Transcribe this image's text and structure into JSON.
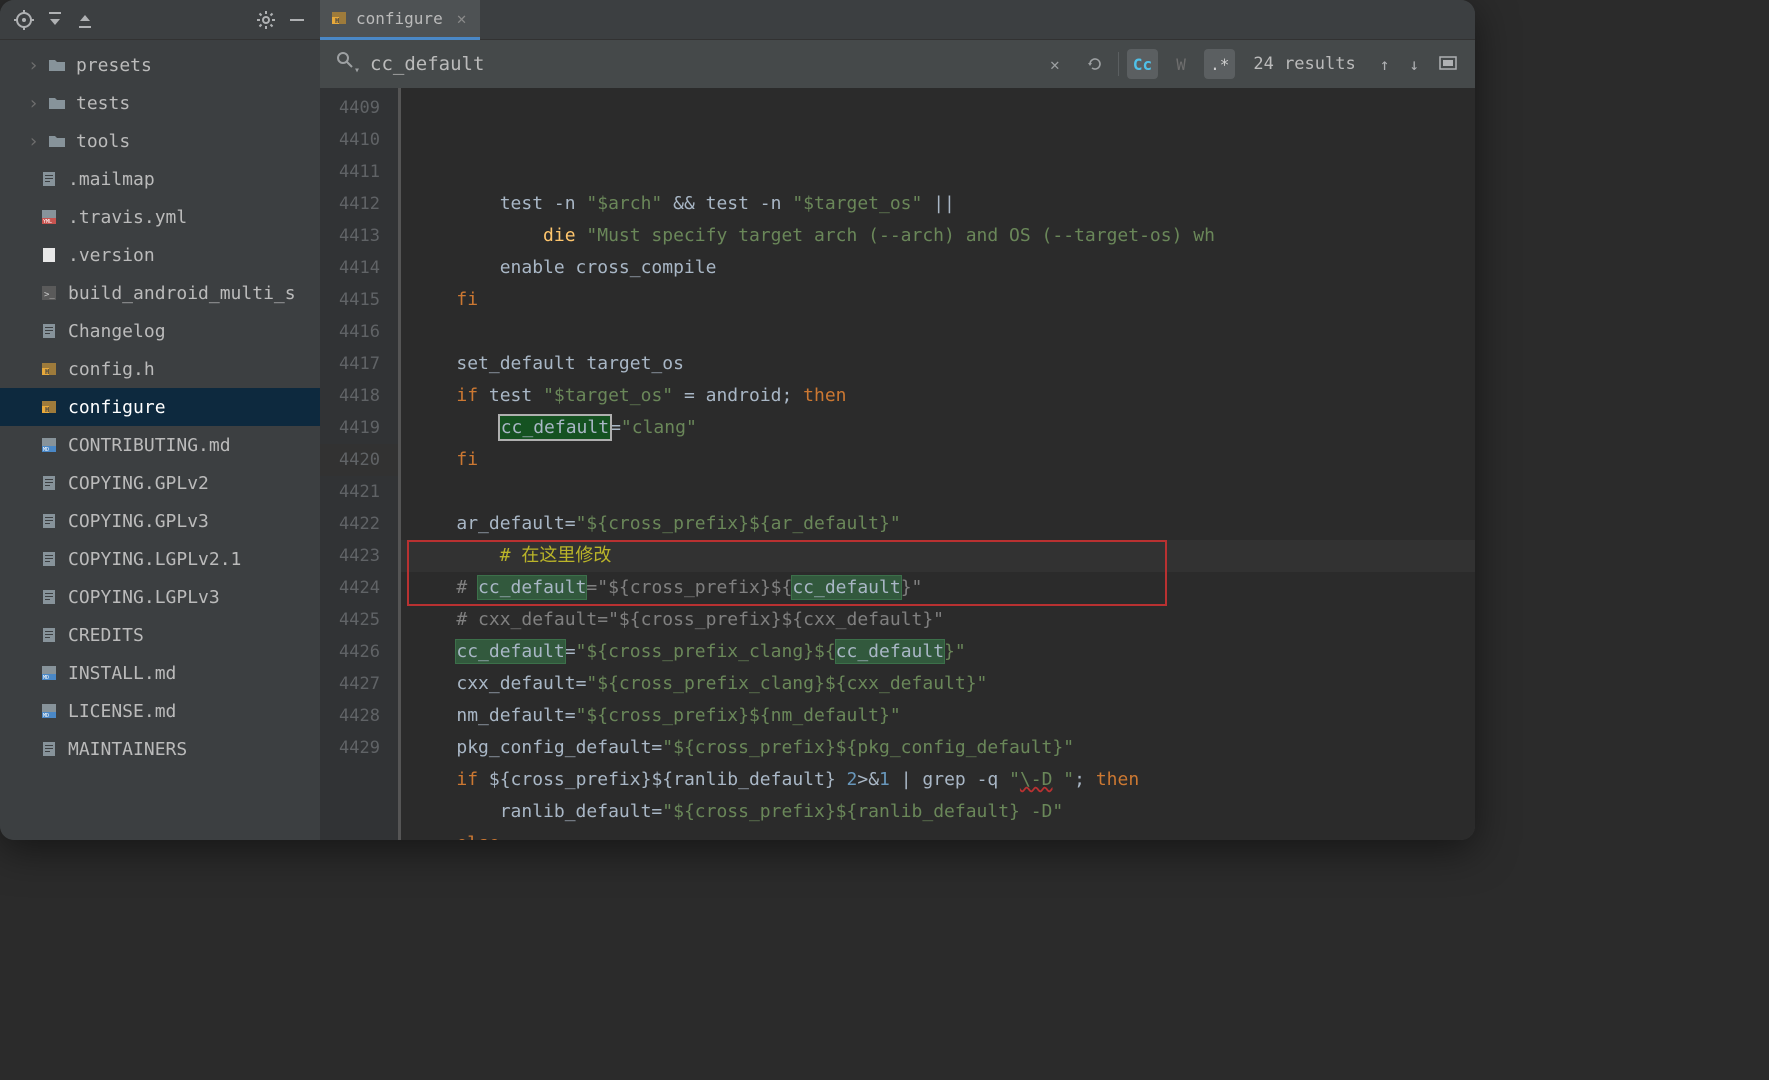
{
  "tab": {
    "title": "configure"
  },
  "search": {
    "query": "cc_default",
    "results": "24 results",
    "cc_label": "Cc",
    "w_label": "W",
    "regex_label": ".*"
  },
  "sidebar": {
    "items": [
      {
        "name": "presets",
        "type": "folder",
        "expandable": true
      },
      {
        "name": "tests",
        "type": "folder",
        "expandable": true
      },
      {
        "name": "tools",
        "type": "folder",
        "expandable": true
      },
      {
        "name": ".mailmap",
        "type": "text"
      },
      {
        "name": ".travis.yml",
        "type": "yml"
      },
      {
        "name": ".version",
        "type": "blank"
      },
      {
        "name": "build_android_multi_s",
        "type": "sh"
      },
      {
        "name": "Changelog",
        "type": "text"
      },
      {
        "name": "config.h",
        "type": "h"
      },
      {
        "name": "configure",
        "type": "h",
        "selected": true
      },
      {
        "name": "CONTRIBUTING.md",
        "type": "md"
      },
      {
        "name": "COPYING.GPLv2",
        "type": "text"
      },
      {
        "name": "COPYING.GPLv3",
        "type": "text"
      },
      {
        "name": "COPYING.LGPLv2.1",
        "type": "text"
      },
      {
        "name": "COPYING.LGPLv3",
        "type": "text"
      },
      {
        "name": "CREDITS",
        "type": "text"
      },
      {
        "name": "INSTALL.md",
        "type": "md"
      },
      {
        "name": "LICENSE.md",
        "type": "md"
      },
      {
        "name": "MAINTAINERS",
        "type": "text"
      }
    ]
  },
  "gutter": {
    "start": 4409,
    "end": 4429
  },
  "code": {
    "l4409": {
      "indent": "        ",
      "p1": "test -n ",
      "p2": "\"$arch\"",
      "p3": " && test -n ",
      "p4": "\"$target_os\"",
      "p5": " ||"
    },
    "l4410": {
      "indent": "            ",
      "fn": "die",
      "str": " \"Must specify target arch (--arch) and OS (--target-os) wh"
    },
    "l4411": {
      "indent": "        ",
      "p1": "enable cross_compile"
    },
    "l4412": {
      "indent": "    ",
      "kw": "fi"
    },
    "l4413": {
      "indent": ""
    },
    "l4414": {
      "indent": "    ",
      "p1": "set_default target_os"
    },
    "l4415": {
      "indent": "    ",
      "kw": "if",
      "p1": " test ",
      "str": "\"$target_os\"",
      "p2": " = android; ",
      "kw2": "then"
    },
    "l4416": {
      "indent": "        ",
      "hl": "cc_default",
      "p1": "=",
      "str": "\"clang\""
    },
    "l4417": {
      "indent": "    ",
      "kw": "fi"
    },
    "l4418": {
      "indent": ""
    },
    "l4419": {
      "indent": "    ",
      "p1": "ar_default=",
      "str": "\"${cross_prefix}${ar_default}\""
    },
    "l4420": {
      "indent": "        ",
      "cmt": "# 在这里修改"
    },
    "l4421": {
      "indent": "    ",
      "cmt1": "# ",
      "hl": "cc_default",
      "cmt2": "=\"${cross_prefix}${",
      "hl2": "cc_default",
      "cmt3": "}\""
    },
    "l4422": {
      "indent": "    ",
      "cmt": "# cxx_default=\"${cross_prefix}${cxx_default}\""
    },
    "l4423": {
      "indent": "    ",
      "hl": "cc_default",
      "p1": "=",
      "s1": "\"${cross_prefix_clang}${",
      "hl2": "cc_default",
      "s2": "}\""
    },
    "l4424": {
      "indent": "    ",
      "p0": "cxx_default=",
      "str": "\"${cross_prefix_clang}${cxx_default}\""
    },
    "l4425": {
      "indent": "    ",
      "p0": "nm_default=",
      "str": "\"${cross_prefix}${nm_default}\""
    },
    "l4426": {
      "indent": "    ",
      "p0": "pkg_config_default=",
      "str": "\"${cross_prefix}${pkg_config_default}\""
    },
    "l4427": {
      "indent": "    ",
      "kw": "if",
      "p1": " ${cross_prefix}${ranlib_default} ",
      "num": "2",
      "p2": ">&",
      "num2": "1",
      "p3": " | grep -q ",
      "s1": "\"",
      "wavy": "\\-D",
      "s2": " \"",
      "p4": "; ",
      "kw2": "then"
    },
    "l4428": {
      "indent": "        ",
      "p0": "ranlib_default=",
      "str": "\"${cross_prefix}${ranlib_default} -D\""
    },
    "l4429": {
      "indent": "    ",
      "kw": "else"
    }
  }
}
